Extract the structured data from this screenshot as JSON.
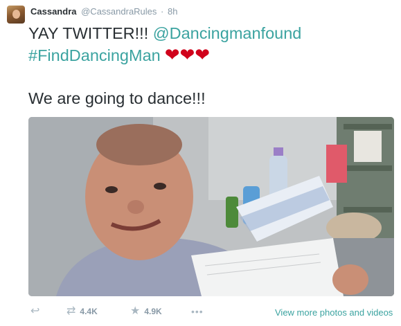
{
  "tweet": {
    "author_name": "Cassandra",
    "author_handle": "@CassandraRules",
    "separator": "·",
    "timestamp": "8h",
    "line1_text": "YAY TWITTER!!! ",
    "line1_mention": "@Dancingmanfound",
    "line2_hashtag": "#FindDancingMan",
    "line2_hearts": "❤❤❤",
    "line3_text": "We are going to dance!!!"
  },
  "media": {
    "description_icon": "photo"
  },
  "actions": {
    "reply_icon": "↩",
    "retweet_icon": "⇄",
    "retweet_count": "4.4K",
    "favorite_icon": "★",
    "favorite_count": "4.9K",
    "more_icon": "•••",
    "view_more_label": "View more photos and videos"
  },
  "colors": {
    "link": "#3ba3a0",
    "heart": "#d0021b",
    "muted": "#8899a6"
  }
}
